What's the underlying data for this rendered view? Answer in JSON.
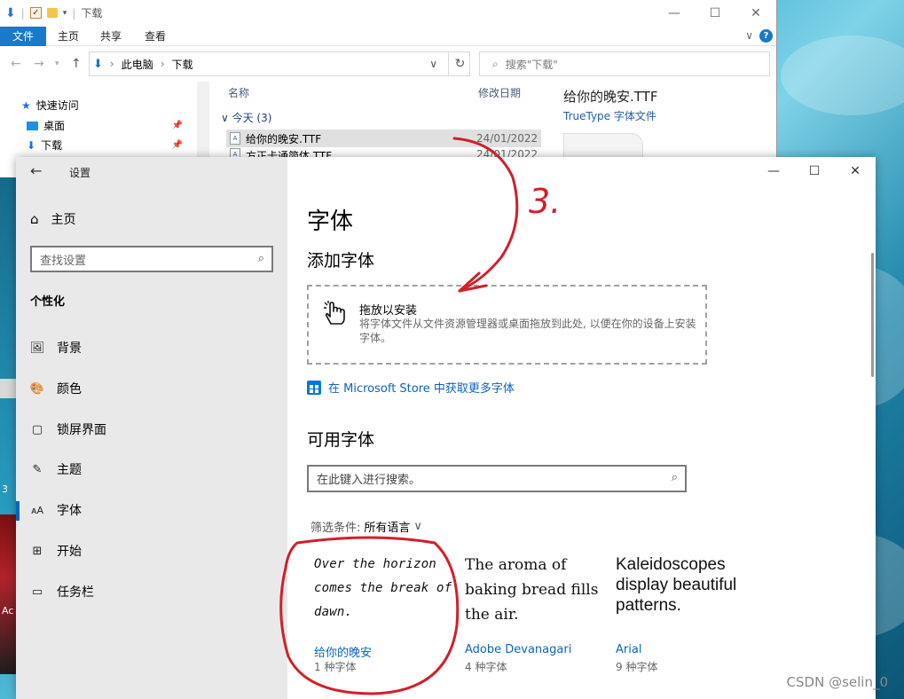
{
  "explorer": {
    "title": "下载",
    "ribbon_tabs": [
      "文件",
      "主页",
      "共享",
      "查看"
    ],
    "breadcrumb": [
      "此电脑",
      "下载"
    ],
    "search_placeholder": "搜索\"下载\"",
    "nav_items": [
      {
        "label": "快速访问",
        "icon": "star-icon"
      },
      {
        "label": "桌面",
        "icon": "desktop-icon"
      },
      {
        "label": "下载",
        "icon": "download-icon"
      }
    ],
    "columns": {
      "name": "名称",
      "modified": "修改日期"
    },
    "group_label": "今天 (3)",
    "files": [
      {
        "name": "给你的晚安.TTF",
        "date": "24/01/2022",
        "selected": true
      },
      {
        "name": "方正卡通简体.TTF",
        "date": "24/01/2022",
        "selected": false
      }
    ],
    "preview": {
      "name": "给你的晚安.TTF",
      "type": "TrueType 字体文件"
    }
  },
  "settings": {
    "app_title": "设置",
    "home_label": "主页",
    "search_placeholder": "查找设置",
    "section_title": "个性化",
    "nav": [
      {
        "label": "背景",
        "icon": "image-icon",
        "active": false
      },
      {
        "label": "颜色",
        "icon": "palette-icon",
        "active": false
      },
      {
        "label": "锁屏界面",
        "icon": "lock-screen-icon",
        "active": false
      },
      {
        "label": "主题",
        "icon": "theme-icon",
        "active": false
      },
      {
        "label": "字体",
        "icon": "font-icon",
        "active": true
      },
      {
        "label": "开始",
        "icon": "start-icon",
        "active": false
      },
      {
        "label": "任务栏",
        "icon": "taskbar-icon",
        "active": false
      }
    ],
    "page_title": "字体",
    "add_fonts_heading": "添加字体",
    "drop_title": "拖放以安装",
    "drop_desc": "将字体文件从文件资源管理器或桌面拖放到此处, 以便在你的设备上安装字体。",
    "store_link": "在 Microsoft Store 中获取更多字体",
    "available_heading": "可用字体",
    "font_search_placeholder": "在此键入进行搜索。",
    "filter_label": "筛选条件:",
    "filter_value": "所有语言",
    "fonts": [
      {
        "sample": "Over the horizon comes the break of dawn.",
        "name": "给你的晚安",
        "count": "1 种字体"
      },
      {
        "sample": "The aroma of baking bread fills the air.",
        "name": "Adobe Devanagari",
        "count": "4 种字体"
      },
      {
        "sample": "Kaleidoscopes display beautiful patterns.",
        "name": "Arial",
        "count": "9 种字体"
      }
    ]
  },
  "annotation": {
    "step_label": "3.",
    "color": "#d0202a"
  },
  "watermark": "CSDN @selin_0",
  "desktop_fragments": {
    "a": "3",
    "b": "Ac"
  }
}
